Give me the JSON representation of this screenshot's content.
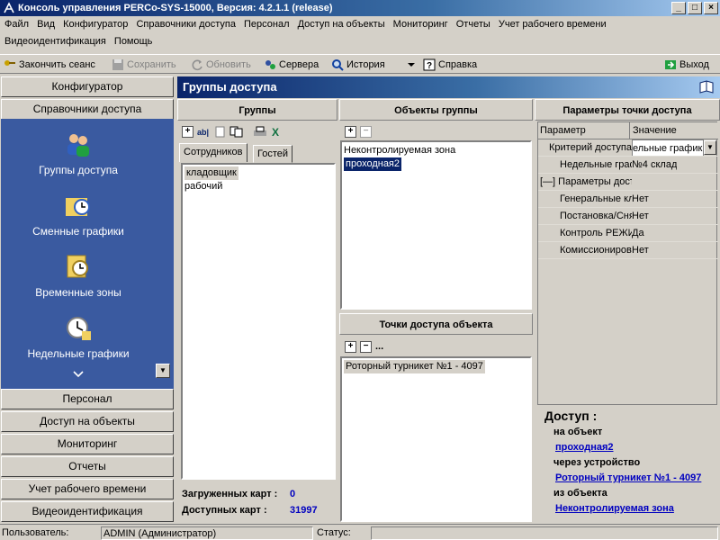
{
  "window": {
    "title": "Консоль управления PERCo-SYS-15000, Версия: 4.2.1.1 (release)",
    "min": "_",
    "max": "□",
    "close": "×"
  },
  "menu": [
    "Файл",
    "Вид",
    "Конфигуратор",
    "Справочники доступа",
    "Персонал",
    "Доступ на объекты",
    "Мониторинг",
    "Отчеты",
    "Учет рабочего времени",
    "Видеоидентификация",
    "Помощь"
  ],
  "toolbar": {
    "end_session": "Закончить сеанс",
    "save": "Сохранить",
    "refresh": "Обновить",
    "servers": "Сервера",
    "history": "История",
    "help": "Справка",
    "exit": "Выход"
  },
  "nav": {
    "configurator": "Конфигуратор",
    "access_dirs": "Справочники доступа",
    "items": [
      "Группы доступа",
      "Сменные графики",
      "Временные зоны",
      "Недельные графики"
    ],
    "personnel": "Персонал",
    "access_objects": "Доступ на объекты",
    "monitoring": "Мониторинг",
    "reports": "Отчеты",
    "time_tracking": "Учет рабочего времени",
    "video_id": "Видеоидентификация"
  },
  "header": {
    "title": "Группы доступа"
  },
  "groups": {
    "title": "Группы",
    "tabs": [
      "Сотрудников",
      "Гостей"
    ],
    "items": [
      "кладовщик",
      "рабочий"
    ],
    "loaded_label": "Загруженных карт :",
    "loaded_value": "0",
    "available_label": "Доступных карт :",
    "available_value": "31997"
  },
  "objects": {
    "title": "Объекты группы",
    "items": [
      "Неконтролируемая зона",
      "проходная2"
    ]
  },
  "points": {
    "title": "Точки доступа объекта",
    "items": [
      "Роторный турникет №1 - 4097"
    ]
  },
  "params": {
    "title": "Параметры точки доступа",
    "col_param": "Параметр",
    "col_value": "Значение",
    "rows": [
      {
        "name": "Критерий доступа",
        "value": "ельные графики"
      },
      {
        "name": "Недельные графики",
        "value": "№4 склад"
      },
      {
        "name": "[—] Параметры доступа",
        "value": ""
      },
      {
        "name": "Генеральные ключи",
        "value": "Нет"
      },
      {
        "name": "Постановка/Снятие",
        "value": "Нет"
      },
      {
        "name": "Контроль РЕЖИМА",
        "value": "Да"
      },
      {
        "name": "Комиссионирование",
        "value": "Нет"
      }
    ]
  },
  "access": {
    "title": "Доступ :",
    "to_object": "на объект",
    "object_link": "проходная2",
    "via_device": "через устройство",
    "device_link": "Роторный турникет №1 - 4097",
    "from_object": "из объекта",
    "from_link": "Неконтролируемая зона"
  },
  "status": {
    "user_label": "Пользователь:",
    "user_value": "ADMIN (Администратор)",
    "status_label": "Статус:",
    "status_value": ""
  },
  "colors": {
    "accent": "#0a246a",
    "nav_bg": "#3a5aa0",
    "link": "#0000c0"
  }
}
